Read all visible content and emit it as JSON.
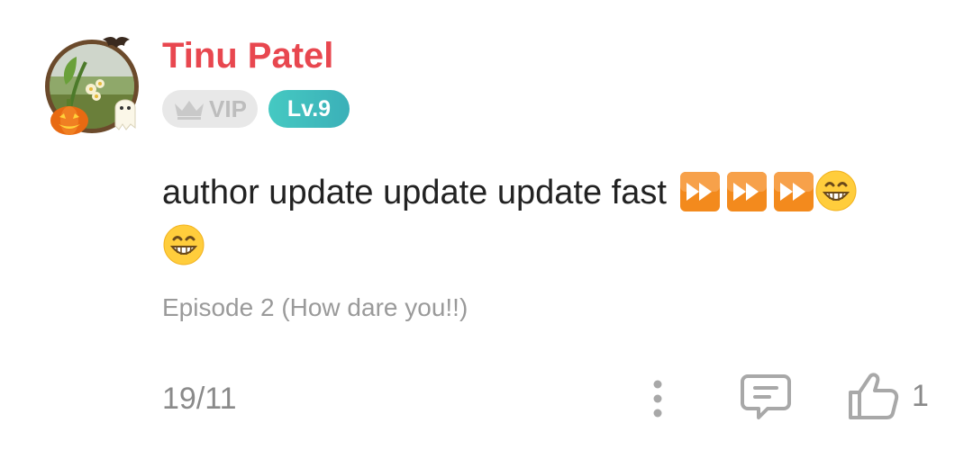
{
  "user": {
    "name": "Tinu Patel",
    "vip_label": "VIP",
    "level_label": "Lv.9"
  },
  "comment": {
    "text": "author update update update fast",
    "emojis": [
      "fast-forward-icon",
      "fast-forward-icon",
      "fast-forward-icon",
      "grinning-face-icon",
      "grinning-face-icon"
    ],
    "episode": "Episode 2 (How dare you!!)",
    "date": "19/11",
    "like_count": "1"
  },
  "colors": {
    "username": "#e8474f",
    "level_badge": "#45c9c2",
    "vip_badge_bg": "#e8e8e8",
    "muted_text": "#8a8a8a",
    "fast_forward": "#f38a1d",
    "emoji_yellow": "#ffcd3c"
  }
}
